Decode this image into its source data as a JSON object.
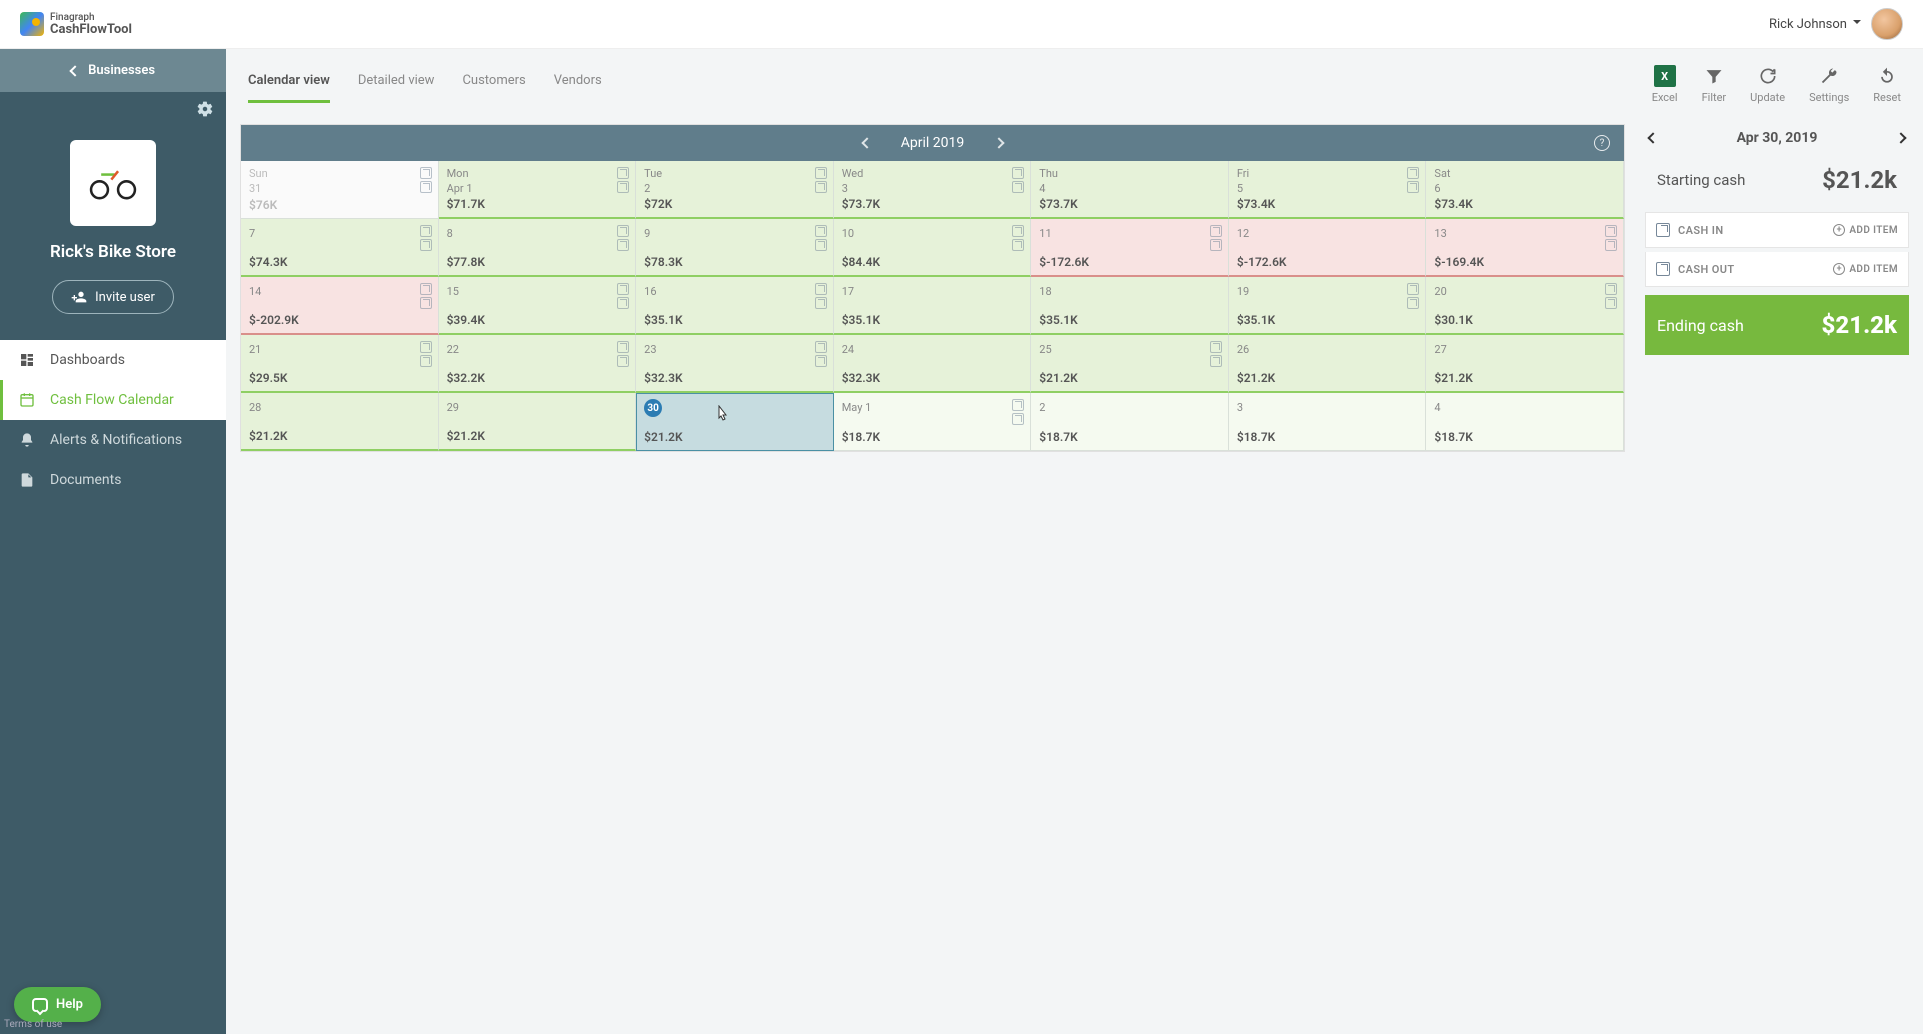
{
  "topbar": {
    "brand_small": "Finagraph",
    "brand": "CashFlowTool",
    "user_name": "Rick Johnson"
  },
  "sidebar": {
    "back_label": "Businesses",
    "business_name": "Rick's Bike Store",
    "invite_label": "Invite user",
    "nav": [
      {
        "label": "Dashboards",
        "active": false,
        "white": true
      },
      {
        "label": "Cash Flow Calendar",
        "active": true
      },
      {
        "label": "Alerts & Notifications",
        "active": false
      },
      {
        "label": "Documents",
        "active": false
      }
    ]
  },
  "tabs": [
    {
      "label": "Calendar view",
      "active": true
    },
    {
      "label": "Detailed view",
      "active": false
    },
    {
      "label": "Customers",
      "active": false
    },
    {
      "label": "Vendors",
      "active": false
    }
  ],
  "actions": [
    {
      "label": "Excel",
      "icon": "excel"
    },
    {
      "label": "Filter",
      "icon": "filter"
    },
    {
      "label": "Update",
      "icon": "update"
    },
    {
      "label": "Settings",
      "icon": "settings"
    },
    {
      "label": "Reset",
      "icon": "reset"
    }
  ],
  "calendar": {
    "month_label": "April 2019",
    "weeks": [
      [
        {
          "dow": "Sun",
          "dnum": "31",
          "amt": "$76K",
          "state": "dim",
          "icons": 2
        },
        {
          "dow": "Mon",
          "dnum": "Apr 1",
          "amt": "$71.7K",
          "state": "green",
          "icons": 2
        },
        {
          "dow": "Tue",
          "dnum": "2",
          "amt": "$72K",
          "state": "green",
          "icons": 2
        },
        {
          "dow": "Wed",
          "dnum": "3",
          "amt": "$73.7K",
          "state": "green",
          "icons": 2
        },
        {
          "dow": "Thu",
          "dnum": "4",
          "amt": "$73.7K",
          "state": "green",
          "icons": 0
        },
        {
          "dow": "Fri",
          "dnum": "5",
          "amt": "$73.4K",
          "state": "green",
          "icons": 2
        },
        {
          "dow": "Sat",
          "dnum": "6",
          "amt": "$73.4K",
          "state": "green",
          "icons": 0
        }
      ],
      [
        {
          "dnum": "7",
          "amt": "$74.3K",
          "state": "green",
          "icons": 2
        },
        {
          "dnum": "8",
          "amt": "$77.8K",
          "state": "green",
          "icons": 2
        },
        {
          "dnum": "9",
          "amt": "$78.3K",
          "state": "green",
          "icons": 2
        },
        {
          "dnum": "10",
          "amt": "$84.4K",
          "state": "green",
          "icons": 2
        },
        {
          "dnum": "11",
          "amt": "$-172.6K",
          "state": "red",
          "icons": 2
        },
        {
          "dnum": "12",
          "amt": "$-172.6K",
          "state": "red",
          "icons": 0
        },
        {
          "dnum": "13",
          "amt": "$-169.4K",
          "state": "red",
          "icons": 2
        }
      ],
      [
        {
          "dnum": "14",
          "amt": "$-202.9K",
          "state": "red",
          "icons": 2
        },
        {
          "dnum": "15",
          "amt": "$39.4K",
          "state": "green",
          "icons": 2
        },
        {
          "dnum": "16",
          "amt": "$35.1K",
          "state": "green",
          "icons": 2
        },
        {
          "dnum": "17",
          "amt": "$35.1K",
          "state": "green",
          "icons": 0
        },
        {
          "dnum": "18",
          "amt": "$35.1K",
          "state": "green",
          "icons": 0
        },
        {
          "dnum": "19",
          "amt": "$35.1K",
          "state": "green",
          "icons": 2
        },
        {
          "dnum": "20",
          "amt": "$30.1K",
          "state": "green",
          "icons": 2
        }
      ],
      [
        {
          "dnum": "21",
          "amt": "$29.5K",
          "state": "green",
          "icons": 2
        },
        {
          "dnum": "22",
          "amt": "$32.2K",
          "state": "green",
          "icons": 2
        },
        {
          "dnum": "23",
          "amt": "$32.3K",
          "state": "green",
          "icons": 2
        },
        {
          "dnum": "24",
          "amt": "$32.3K",
          "state": "green",
          "icons": 0
        },
        {
          "dnum": "25",
          "amt": "$21.2K",
          "state": "green",
          "icons": 2
        },
        {
          "dnum": "26",
          "amt": "$21.2K",
          "state": "green",
          "icons": 0
        },
        {
          "dnum": "27",
          "amt": "$21.2K",
          "state": "green",
          "icons": 0
        }
      ],
      [
        {
          "dnum": "28",
          "amt": "$21.2K",
          "state": "green",
          "icons": 0
        },
        {
          "dnum": "29",
          "amt": "$21.2K",
          "state": "green",
          "icons": 0
        },
        {
          "dnum": "30",
          "amt": "$21.2K",
          "state": "selected",
          "icons": 0,
          "today": true,
          "cursor": true
        },
        {
          "dnum": "May 1",
          "amt": "$18.7K",
          "state": "dim-green",
          "icons": 2
        },
        {
          "dnum": "2",
          "amt": "$18.7K",
          "state": "dim-green",
          "icons": 0
        },
        {
          "dnum": "3",
          "amt": "$18.7K",
          "state": "dim-green",
          "icons": 0
        },
        {
          "dnum": "4",
          "amt": "$18.7K",
          "state": "dim-green",
          "icons": 0
        }
      ]
    ]
  },
  "right_panel": {
    "date_label": "Apr 30, 2019",
    "starting_label": "Starting cash",
    "starting_value": "$21.2k",
    "cashin_label": "CASH IN",
    "cashout_label": "CASH OUT",
    "add_item_label": "ADD ITEM",
    "ending_label": "Ending cash",
    "ending_value": "$21.2k"
  },
  "help": {
    "label": "Help"
  },
  "terms": "Terms of use"
}
